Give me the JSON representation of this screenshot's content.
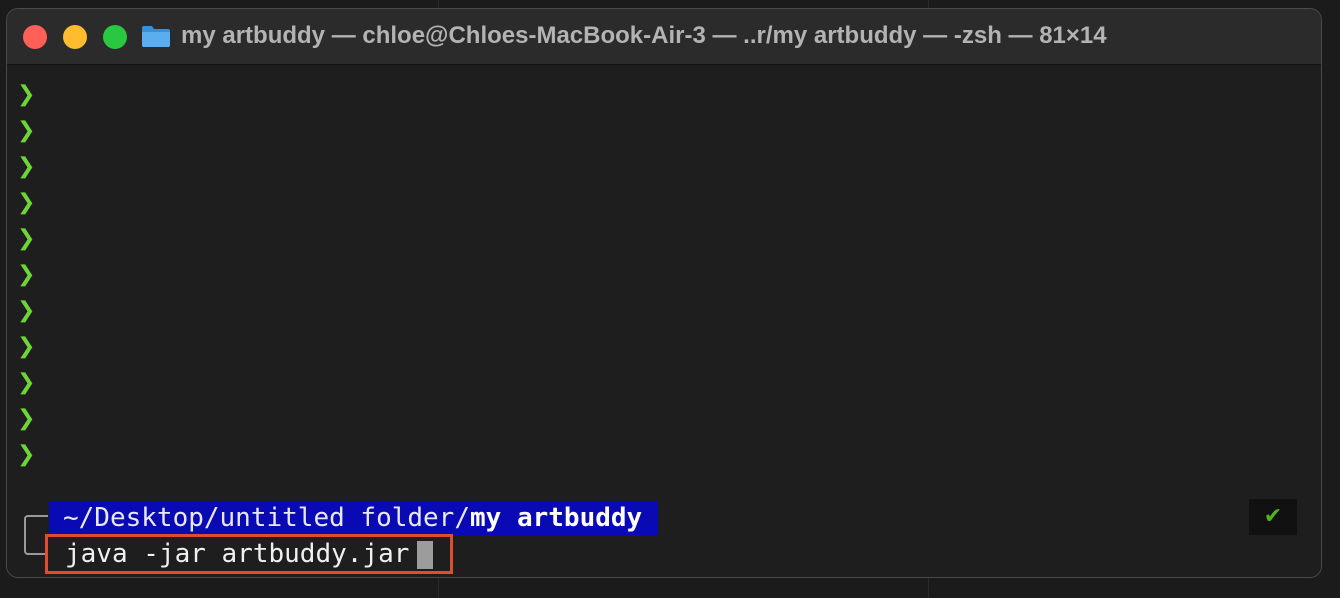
{
  "window": {
    "title": "my artbuddy — chloe@Chloes-MacBook-Air-3 — ..r/my artbuddy — -zsh — 81×14"
  },
  "terminal": {
    "prompt_symbol": "❯",
    "empty_prompt_count": 11,
    "path_prefix": "~/Desktop/untitled folder/",
    "path_current": "my artbuddy",
    "command": "java -jar artbuddy.jar",
    "status_icon": "✔"
  },
  "colors": {
    "prompt": "#6fd43a",
    "path_bg": "#0a0ab4",
    "highlight": "#e04c30",
    "status_ok": "#4fb51f"
  },
  "icons": {
    "folder": "folder-icon",
    "status": "checkmark-icon"
  }
}
